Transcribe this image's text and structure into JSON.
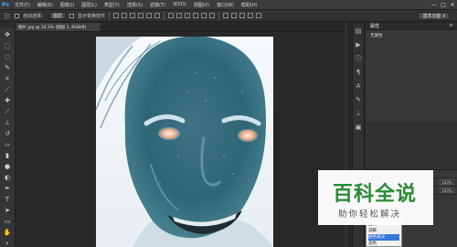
{
  "app": {
    "logo": "Ps"
  },
  "menu": [
    "文件(F)",
    "编辑(E)",
    "图像(I)",
    "图层(L)",
    "类型(Y)",
    "选择(S)",
    "滤镜(T)",
    "3D(D)",
    "视图(V)",
    "窗口(W)",
    "帮助(H)"
  ],
  "window_controls": [
    "—",
    "□",
    "✕"
  ],
  "options": {
    "auto_select_label": "自动选择：",
    "auto_select_value": "图层",
    "transform_label": "显示变换控件",
    "workspace_label": "基本功能"
  },
  "document": {
    "tab_title": "图片.jpg @ 33.3% (图层 1, RGB/8)"
  },
  "tools_icons": [
    "move-icon",
    "marquee-icon",
    "lasso-icon",
    "quick-select-icon",
    "crop-icon",
    "eyedropper-icon",
    "healing-icon",
    "brush-icon",
    "stamp-icon",
    "history-brush-icon",
    "eraser-icon",
    "gradient-icon",
    "blur-icon",
    "dodge-icon",
    "pen-icon",
    "type-icon",
    "path-select-icon",
    "shape-icon",
    "hand-icon",
    "zoom-icon"
  ],
  "panels": {
    "top_tab": "属性",
    "properties_text": "无属性"
  },
  "layers_panel": {
    "opacity_value": "100%",
    "fill_value": "100%"
  },
  "blend_menu": {
    "items": [
      "正常",
      "溶解",
      "颜色减淡",
      "滤色"
    ],
    "selected_index": 2
  },
  "watermark": {
    "title": "百科全说",
    "subtitle": "助你轻松解决"
  }
}
